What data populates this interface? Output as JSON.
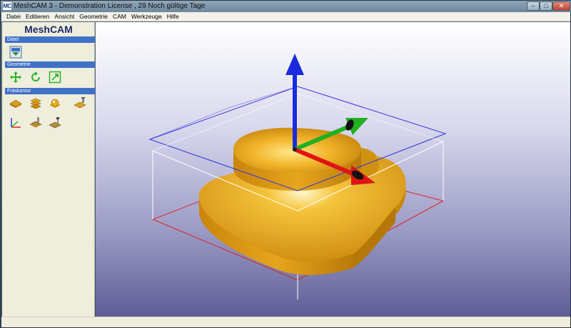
{
  "window": {
    "app_icon_text": "MC",
    "title": "MeshCAM 3 - Demonstration License , 29 Noch gültige Tage",
    "min_glyph": "–",
    "max_glyph": "□",
    "close_glyph": "✕"
  },
  "menu": {
    "items": [
      "Datei",
      "Editieren",
      "Ansicht",
      "Geometrie",
      "CAM",
      "Werkzeuge",
      "Hilfe"
    ]
  },
  "sidebar": {
    "logo": "MeshCAM",
    "sections": [
      {
        "label": "Datei",
        "icons": [
          "open-file-icon"
        ]
      },
      {
        "label": "Geometrie",
        "icons": [
          "move-icon",
          "rotate-icon",
          "scale-icon"
        ]
      },
      {
        "label": "Fräskontur",
        "icons": [
          "set-stock-icon",
          "waterline-icon",
          "region-icon",
          "machine-depth-icon",
          "origin-icon",
          "toolpath-icon",
          "post-process-icon"
        ]
      }
    ]
  },
  "viewport": {
    "background": "#5e5e97",
    "model_color": "#e3a21c",
    "axes": {
      "x_color": "#e01414",
      "y_color": "#20b020",
      "z_color": "#1a2bdc"
    },
    "stock_top_color": "#3333dd",
    "stock_bottom_color": "#dd2222",
    "stock_side_color": "#ffffff"
  }
}
